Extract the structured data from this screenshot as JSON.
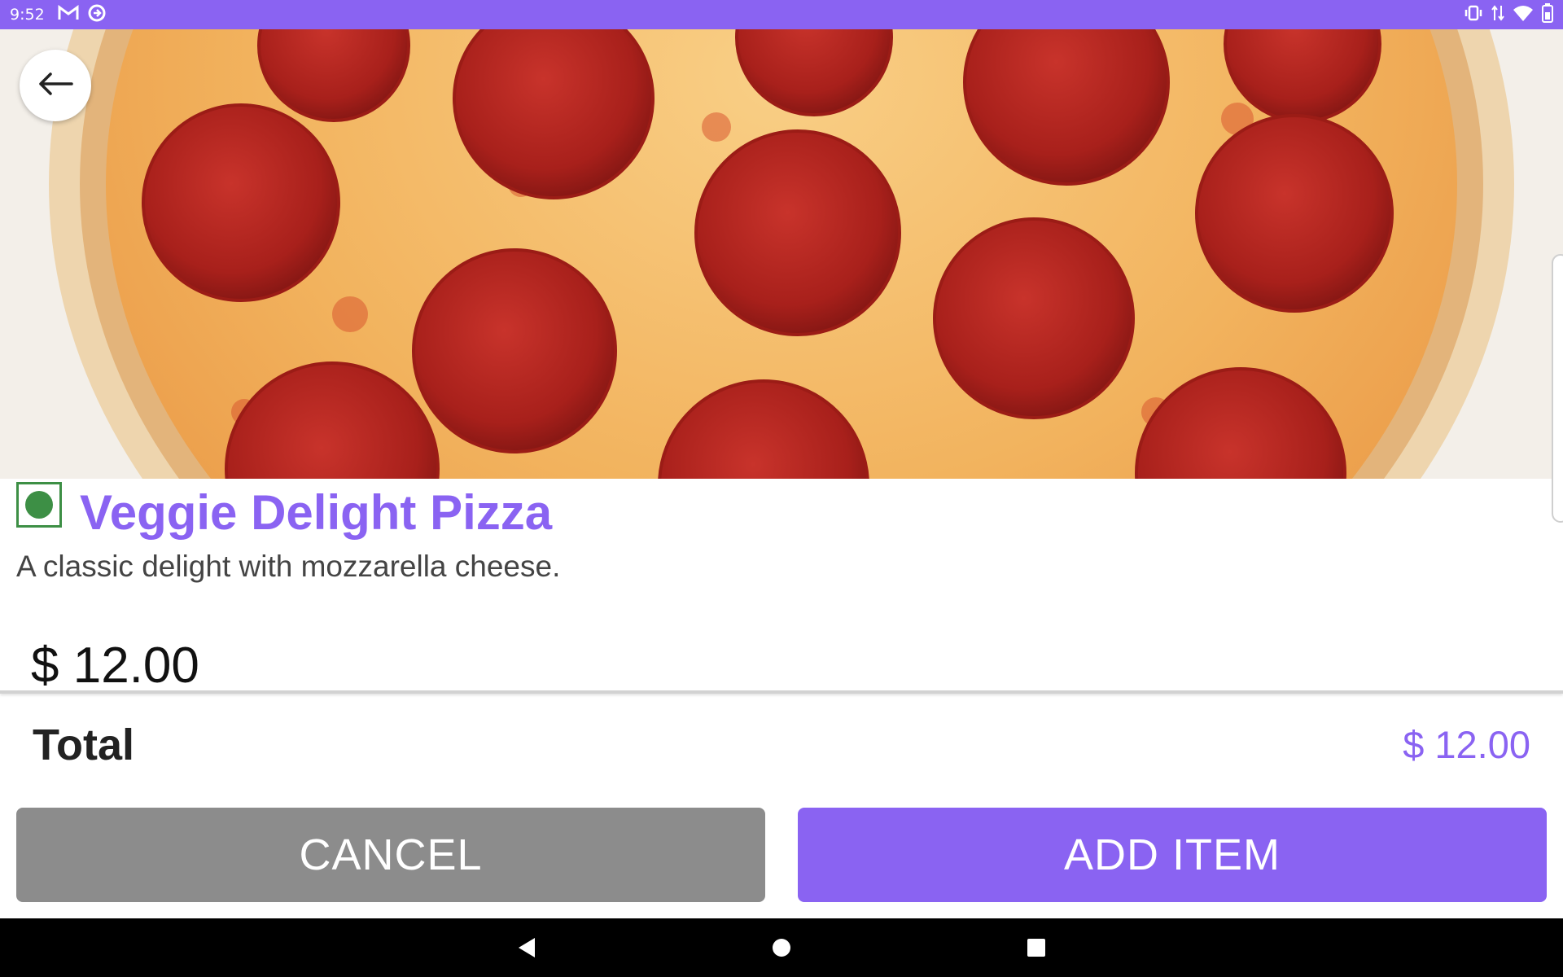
{
  "status_bar": {
    "time": "9:52",
    "left_icons": [
      "gmail-icon",
      "sync-icon"
    ],
    "right_icons": [
      "vibrate-icon",
      "data-arrows-icon",
      "wifi-icon",
      "battery-icon"
    ]
  },
  "hero": {
    "image": "pepperoni-pizza-photo"
  },
  "item": {
    "veg": true,
    "title": "Veggie Delight Pizza",
    "description": "A classic delight with mozzarella cheese.",
    "price": "$ 12.00"
  },
  "footer": {
    "total_label": "Total",
    "total_value": "$ 12.00",
    "cancel_label": "CANCEL",
    "add_label": "ADD ITEM"
  },
  "colors": {
    "accent": "#8a63f2",
    "veg_green": "#3d8f45",
    "cancel_gray": "#8c8c8c"
  },
  "nav_bar": [
    "back-icon",
    "home-icon",
    "recents-icon"
  ]
}
